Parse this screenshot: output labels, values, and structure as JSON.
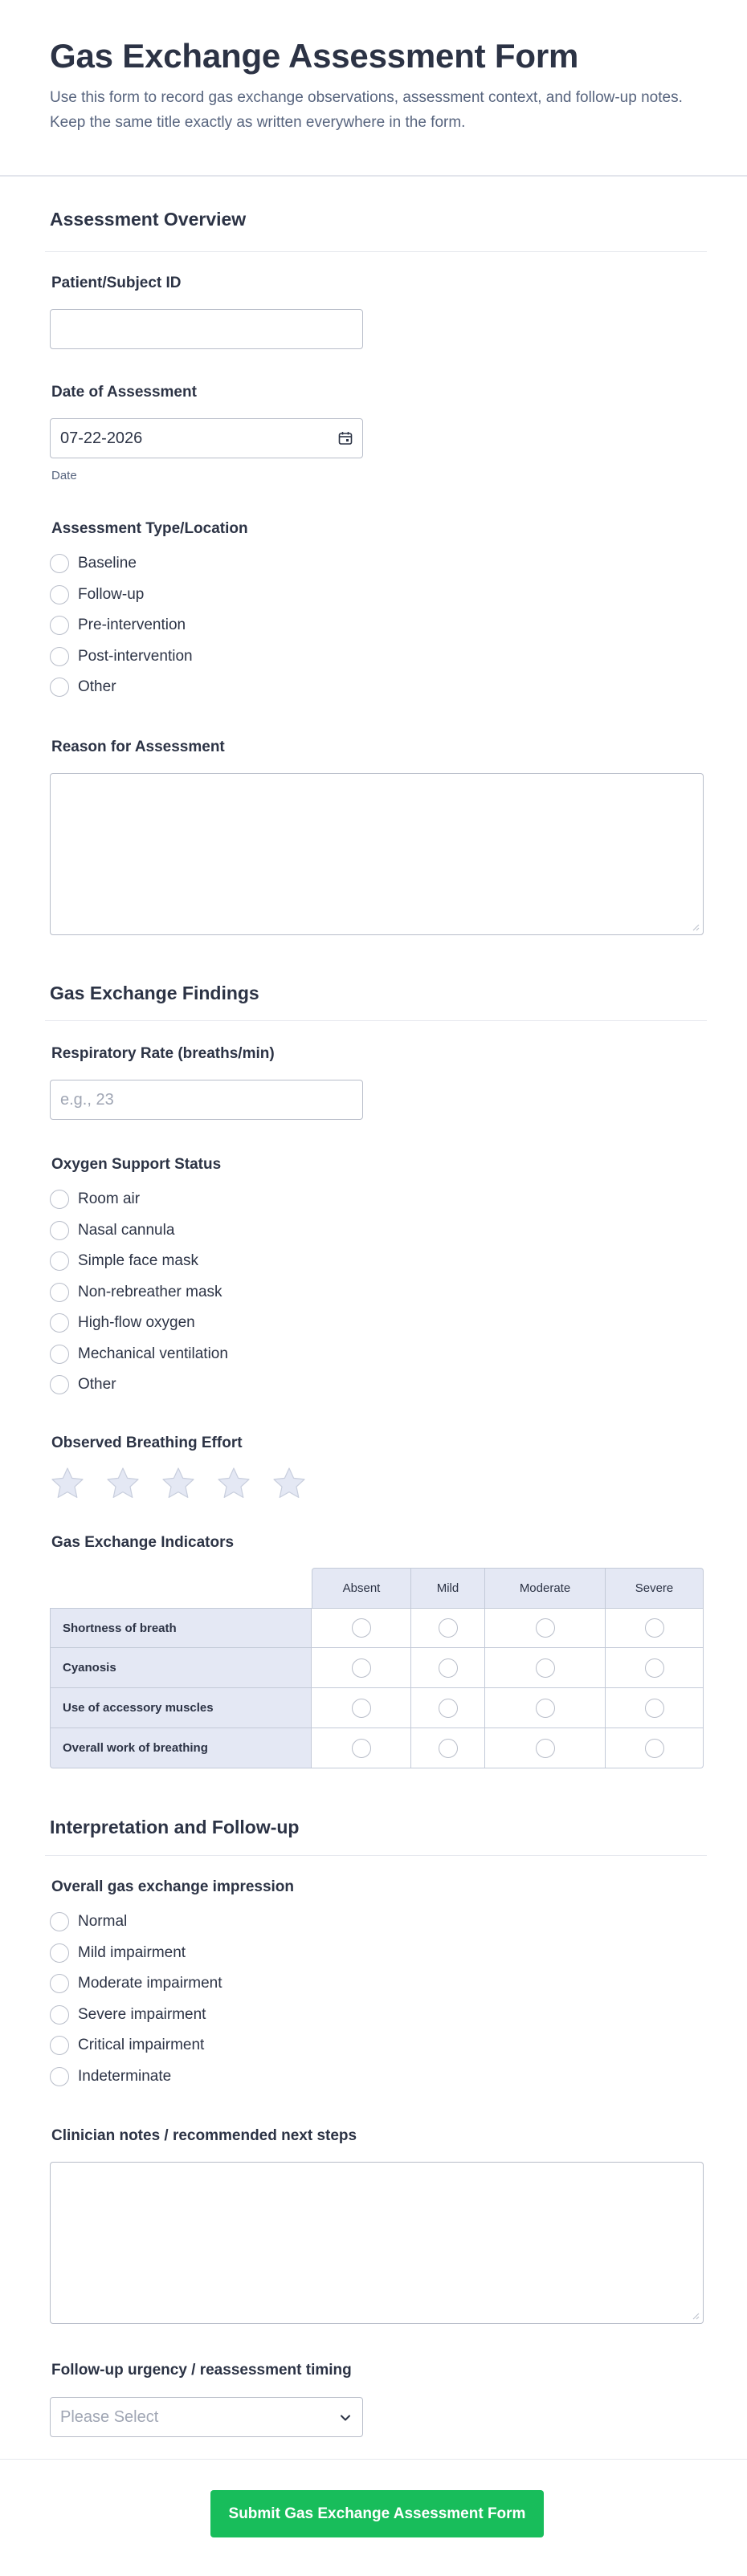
{
  "form": {
    "title": "Gas Exchange Assessment Form",
    "description": "Use this form to record gas exchange observations, assessment context, and follow-up notes. Keep the same title exactly as written everywhere in the form."
  },
  "overview": {
    "heading": "Assessment Overview",
    "patient_id_label": "Patient/Subject ID",
    "patient_id_value": "",
    "date_label": "Date of Assessment",
    "date_value": "07-22-2026",
    "date_sublabel": "Date",
    "type_label": "Assessment Type/Location",
    "type_options": [
      "Baseline",
      "Follow-up",
      "Pre-intervention",
      "Post-intervention",
      "Other"
    ],
    "reason_label": "Reason for Assessment"
  },
  "findings": {
    "heading": "Gas Exchange Findings",
    "resp_rate_label": "Respiratory Rate (breaths/min)",
    "resp_rate_placeholder": "e.g., 23",
    "oxygen_label": "Oxygen Support Status",
    "oxygen_options": [
      "Room air",
      "Nasal cannula",
      "Simple face mask",
      "Non-rebreather mask",
      "High-flow oxygen",
      "Mechanical ventilation",
      "Other"
    ],
    "effort_label": "Observed Breathing Effort",
    "effort_rating": {
      "selected": 0,
      "max": 5
    },
    "indicators_label": "Gas Exchange Indicators",
    "indicators_columns": [
      "Absent",
      "Mild",
      "Moderate",
      "Severe"
    ],
    "indicators_rows": [
      "Shortness of breath",
      "Cyanosis",
      "Use of accessory muscles",
      "Overall work of breathing"
    ]
  },
  "followup": {
    "heading": "Interpretation and Follow-up",
    "impression_label": "Overall gas exchange impression",
    "impression_options": [
      "Normal",
      "Mild impairment",
      "Moderate impairment",
      "Severe impairment",
      "Critical impairment",
      "Indeterminate"
    ],
    "notes_label": "Clinician notes / recommended next steps",
    "urgency_label": "Follow-up urgency / reassessment timing",
    "urgency_placeholder": "Please Select"
  },
  "submit_label": "Submit Gas Exchange Assessment Form",
  "icons": {
    "date": "calendar-icon",
    "select": "chevron-down-icon",
    "rating": "star-icon"
  },
  "colors": {
    "accent": "#18bd5b",
    "text": "#2c3345",
    "muted": "#57647e",
    "matrix_header": "#e4e8f4",
    "star": "#e4e8f4"
  }
}
